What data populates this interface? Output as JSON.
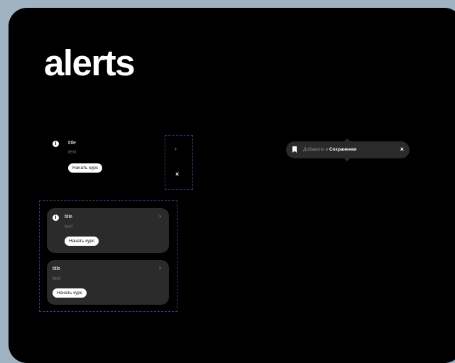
{
  "heading": "alerts",
  "alert_plain": {
    "title": "title",
    "text": "text",
    "button": "Начать курс"
  },
  "side_column": {
    "chevron": "›",
    "close": "×"
  },
  "toast": {
    "prefix": "Добавили в",
    "link": "Сохраненки",
    "close": "×"
  },
  "card_with_icon": {
    "title": "title",
    "text": "text",
    "button": "Начать курс",
    "chevron": "›"
  },
  "card_plain": {
    "title": "title",
    "text": "text",
    "button": "Начать курс",
    "chevron": "›"
  }
}
